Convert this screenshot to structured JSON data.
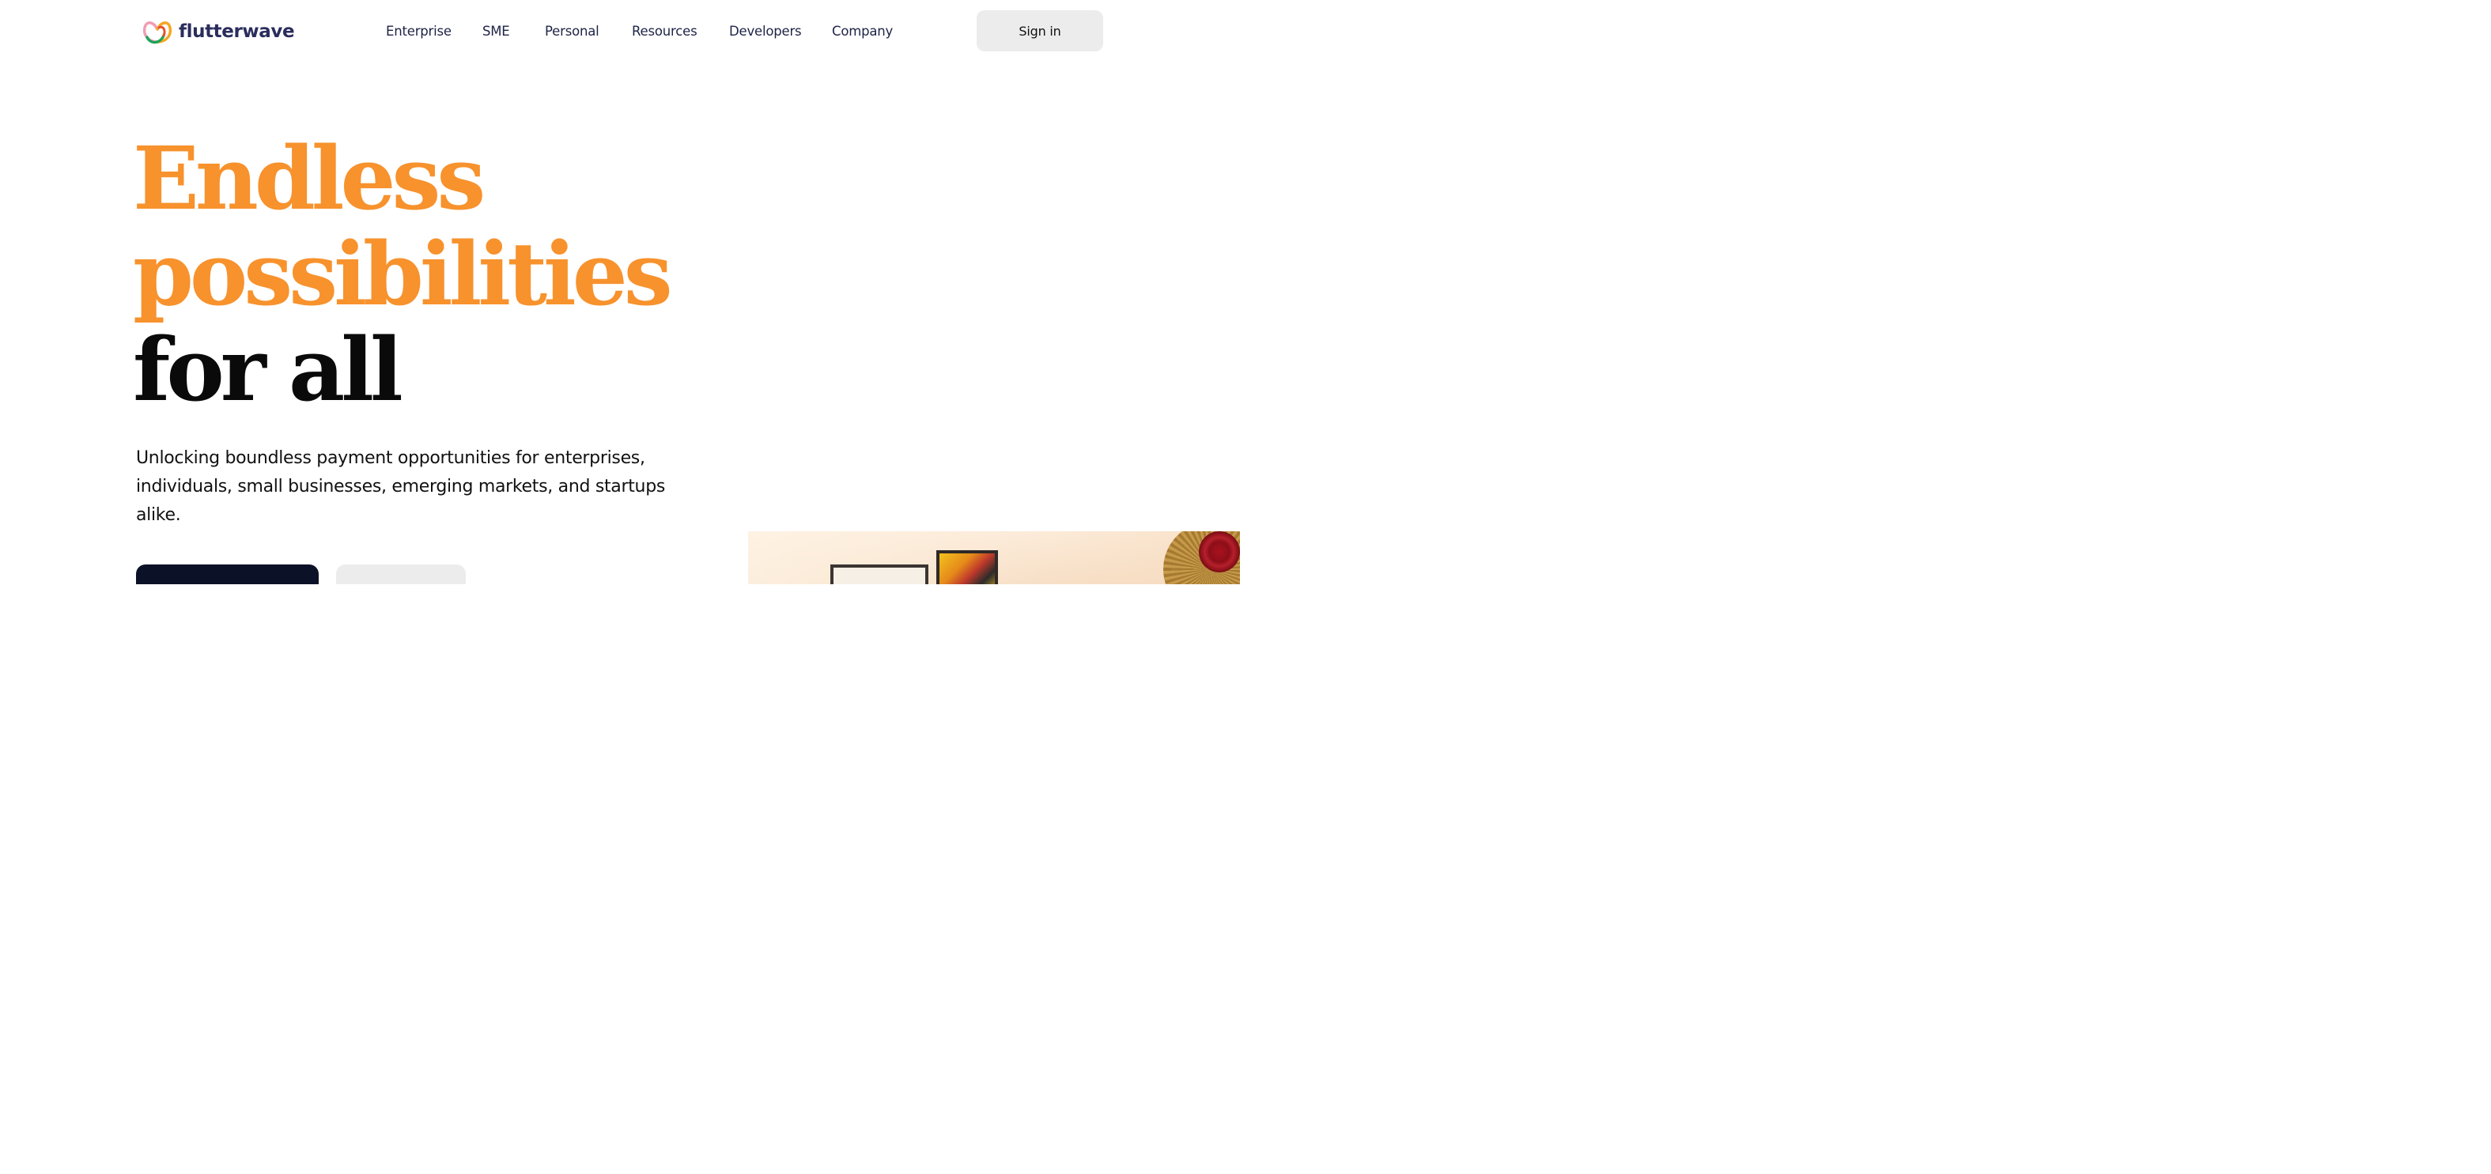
{
  "brand": {
    "name": "flutterwave",
    "colors": {
      "orange": "#f7922d",
      "navy": "#2a2d5c",
      "logo_yellow": "#f5a623",
      "logo_pink": "#f29bb4",
      "logo_green": "#1ea35a"
    }
  },
  "nav": {
    "items": [
      {
        "label": "Enterprise"
      },
      {
        "label": "SME"
      },
      {
        "label": "Personal"
      },
      {
        "label": "Resources"
      },
      {
        "label": "Developers"
      },
      {
        "label": "Company"
      }
    ],
    "signin_label": "Sign in"
  },
  "hero": {
    "title_line_1": "Endless",
    "title_line_2": "possibilities",
    "title_line_3": "for all",
    "subtitle": "Unlocking boundless payment opportunities for enterprises, individuals, small businesses, emerging markets, and startups alike."
  },
  "icons": {
    "logo": "flutterwave-logo-icon"
  }
}
